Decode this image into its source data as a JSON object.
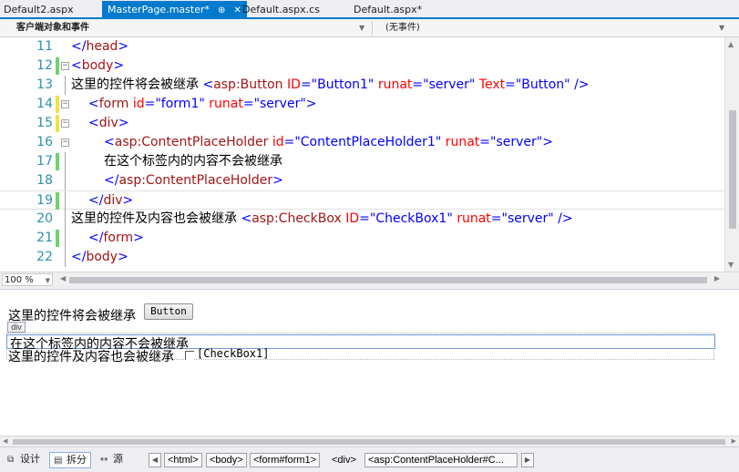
{
  "tabs": [
    {
      "label": "Default2.aspx",
      "active": false
    },
    {
      "label": "MasterPage.master*",
      "active": true,
      "pin_glyph": "⊕",
      "close_glyph": "✕"
    },
    {
      "label": "Default.aspx.cs",
      "active": false
    },
    {
      "label": "Default.aspx*",
      "active": false
    }
  ],
  "member_bar": {
    "object": "客户端对象和事件",
    "event": "(无事件)"
  },
  "editor": {
    "current_line": 19,
    "lines": [
      {
        "num": "11",
        "change": "none",
        "fold": "none"
      },
      {
        "num": "12",
        "change": "green",
        "fold": "minus"
      },
      {
        "num": "13",
        "change": "none",
        "fold": "none"
      },
      {
        "num": "14",
        "change": "yellow",
        "fold": "minus"
      },
      {
        "num": "15",
        "change": "yellow",
        "fold": "minus"
      },
      {
        "num": "16",
        "change": "none",
        "fold": "minus"
      },
      {
        "num": "17",
        "change": "green",
        "fold": "none"
      },
      {
        "num": "18",
        "change": "none",
        "fold": "none"
      },
      {
        "num": "19",
        "change": "green",
        "fold": "none"
      },
      {
        "num": "20",
        "change": "none",
        "fold": "none"
      },
      {
        "num": "21",
        "change": "green",
        "fold": "none"
      },
      {
        "num": "22",
        "change": "none",
        "fold": "none"
      }
    ],
    "code": {
      "l11": {
        "open": "</",
        "name": "head",
        "close": ">"
      },
      "l12": {
        "open": "<",
        "name": "body",
        "close": ">"
      },
      "l13": {
        "text": "这里的控件将会被继承 ",
        "open": "<",
        "name": "asp:Button",
        "a1": "ID",
        "v1": "\"Button1\"",
        "a2": "runat",
        "v2": "\"server\"",
        "a3": "Text",
        "v3": "\"Button\"",
        "close": " />"
      },
      "l14": {
        "open": "<",
        "name": "form",
        "a1": "id",
        "v1": "\"form1\"",
        "a2": "runat",
        "v2": "\"server\"",
        "close": ">"
      },
      "l15": {
        "open": "<",
        "name": "div",
        "close": ">"
      },
      "l16": {
        "open": "<",
        "name": "asp:ContentPlaceHolder",
        "a1": "id",
        "v1": "\"ContentPlaceHolder1\"",
        "a2": "runat",
        "v2": "\"server\"",
        "close": ">"
      },
      "l17": {
        "text": "在这个标签内的内容不会被继承"
      },
      "l18": {
        "open": "</",
        "name": "asp:ContentPlaceHolder",
        "close": ">"
      },
      "l19": {
        "open": "</",
        "name": "div",
        "close": ">"
      },
      "l20": {
        "text": "这里的控件及内容也会被继承    ",
        "open": "<",
        "name": "asp:CheckBox",
        "a1": "ID",
        "v1": "\"CheckBox1\"",
        "a2": "runat",
        "v2": "\"server\"",
        "close": " />"
      },
      "l21": {
        "open": "</",
        "name": "form",
        "close": ">"
      },
      "l22": {
        "open": "</",
        "name": "body",
        "close": ">"
      }
    }
  },
  "zoom": "100 %",
  "design": {
    "text1": "这里的控件将会被继承",
    "button_label": "Button",
    "div_tag": "div",
    "placeholder_text": "在这个标签内的内容不会被继承",
    "text2": "这里的控件及内容也会被继承",
    "checkbox_label": "[CheckBox1]",
    "checkbox_checked": false
  },
  "view_buttons": [
    {
      "label": "设计",
      "icon": "design-icon",
      "glyph": "⧉",
      "active": false
    },
    {
      "label": "拆分",
      "icon": "split-icon",
      "glyph": "▤",
      "active": true
    },
    {
      "label": "源",
      "icon": "source-icon",
      "glyph": "↔",
      "active": false
    }
  ],
  "breadcrumb": {
    "items": [
      "<html>",
      "<body>",
      "<form#form1>",
      "<div>",
      "<asp:ContentPlaceHolder#C..."
    ],
    "left_arrow": "◀",
    "right_arrow": "▶"
  },
  "colors": {
    "accent": "#007acc",
    "line_number": "#2b91af",
    "tag_name": "#a31515",
    "delimiter": "#0000ff",
    "attribute": "#ff0000",
    "change_green": "#6fd46f",
    "change_yellow": "#f1e24a"
  }
}
